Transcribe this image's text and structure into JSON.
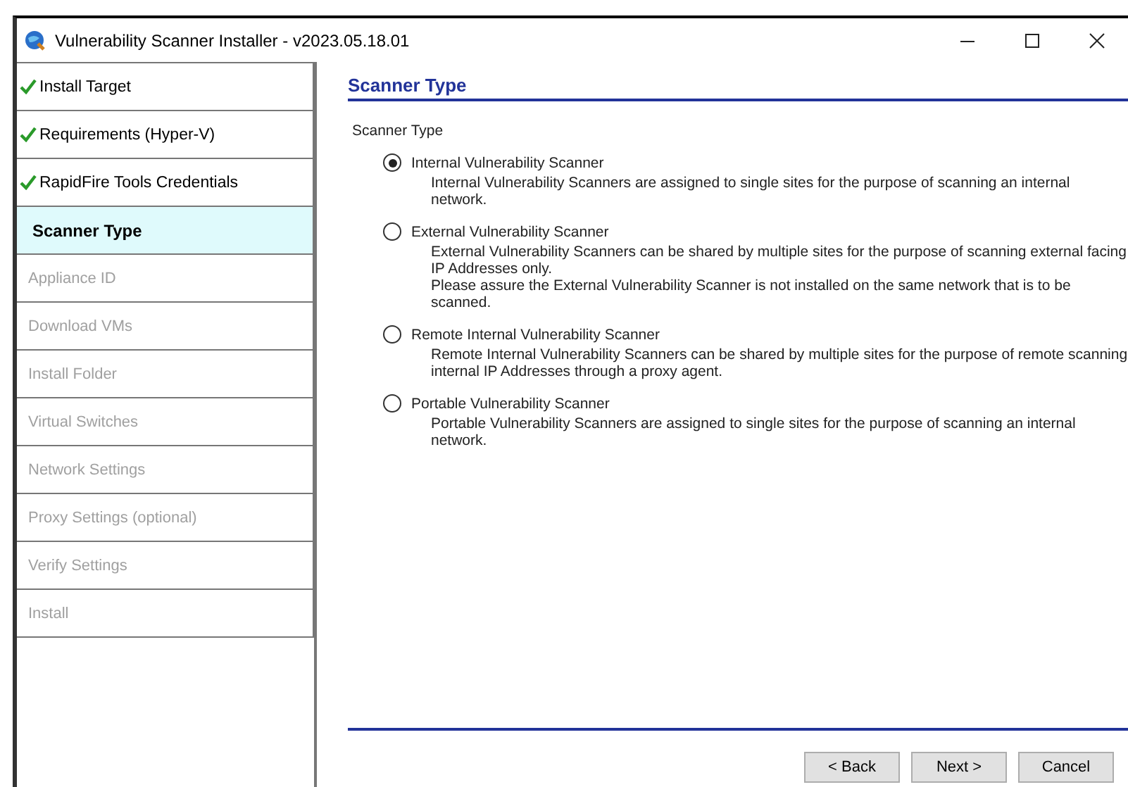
{
  "window": {
    "title": "Vulnerability Scanner Installer - v2023.05.18.01"
  },
  "steps": [
    {
      "label": "Install Target",
      "done": true,
      "selected": false,
      "disabled": false
    },
    {
      "label": "Requirements (Hyper-V)",
      "done": true,
      "selected": false,
      "disabled": false
    },
    {
      "label": "RapidFire Tools Credentials",
      "done": true,
      "selected": false,
      "disabled": false
    },
    {
      "label": "Scanner Type",
      "done": false,
      "selected": true,
      "disabled": false
    },
    {
      "label": "Appliance ID",
      "done": false,
      "selected": false,
      "disabled": true
    },
    {
      "label": "Download VMs",
      "done": false,
      "selected": false,
      "disabled": true
    },
    {
      "label": "Install Folder",
      "done": false,
      "selected": false,
      "disabled": true
    },
    {
      "label": "Virtual Switches",
      "done": false,
      "selected": false,
      "disabled": true
    },
    {
      "label": "Network Settings",
      "done": false,
      "selected": false,
      "disabled": true
    },
    {
      "label": "Proxy Settings (optional)",
      "done": false,
      "selected": false,
      "disabled": true
    },
    {
      "label": "Verify Settings",
      "done": false,
      "selected": false,
      "disabled": true
    },
    {
      "label": "Install",
      "done": false,
      "selected": false,
      "disabled": true
    }
  ],
  "page": {
    "heading": "Scanner Type",
    "group_label": "Scanner Type",
    "options": [
      {
        "label": "Internal Vulnerability Scanner",
        "selected": true,
        "description": [
          "Internal Vulnerability Scanners are assigned to single sites for the purpose of scanning an internal network."
        ]
      },
      {
        "label": "External Vulnerability Scanner",
        "selected": false,
        "description": [
          "External Vulnerability Scanners can be shared by multiple sites for the purpose of scanning external facing IP Addresses only.",
          "Please assure the External Vulnerability Scanner is not installed on the same network that is to be scanned."
        ]
      },
      {
        "label": "Remote Internal Vulnerability Scanner",
        "selected": false,
        "description": [
          "Remote Internal Vulnerability Scanners can be shared by multiple sites for the purpose of remote scanning internal IP Addresses through a proxy agent."
        ]
      },
      {
        "label": "Portable Vulnerability Scanner",
        "selected": false,
        "description": [
          "Portable Vulnerability Scanners are assigned to single sites for the purpose of scanning an internal network."
        ]
      }
    ]
  },
  "buttons": [
    "< Back",
    "Next >",
    "Cancel"
  ]
}
